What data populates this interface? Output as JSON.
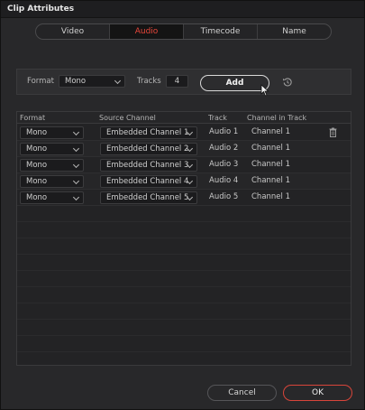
{
  "window": {
    "title": "Clip Attributes"
  },
  "tabs": [
    {
      "label": "Video",
      "active": false
    },
    {
      "label": "Audio",
      "active": true
    },
    {
      "label": "Timecode",
      "active": false
    },
    {
      "label": "Name",
      "active": false
    }
  ],
  "toolbar": {
    "format_label": "Format",
    "format_value": "Mono",
    "tracks_label": "Tracks",
    "tracks_value": "4",
    "add_label": "Add",
    "reset_icon": "reset-icon"
  },
  "table": {
    "headers": {
      "format": "Format",
      "source_channel": "Source Channel",
      "track": "Track",
      "channel_in_track": "Channel in Track"
    },
    "rows": [
      {
        "format": "Mono",
        "source_channel": "Embedded Channel 1",
        "track": "Audio 1",
        "channel_in_track": "Channel 1"
      },
      {
        "format": "Mono",
        "source_channel": "Embedded Channel 2",
        "track": "Audio 2",
        "channel_in_track": "Channel 1"
      },
      {
        "format": "Mono",
        "source_channel": "Embedded Channel 3",
        "track": "Audio 3",
        "channel_in_track": "Channel 1"
      },
      {
        "format": "Mono",
        "source_channel": "Embedded Channel 4",
        "track": "Audio 4",
        "channel_in_track": "Channel 1"
      },
      {
        "format": "Mono",
        "source_channel": "Embedded Channel 5",
        "track": "Audio 5",
        "channel_in_track": "Channel 1"
      }
    ],
    "delete_icon": "trash-icon"
  },
  "footer": {
    "cancel_label": "Cancel",
    "ok_label": "OK"
  },
  "colors": {
    "accent": "#e8463a",
    "background": "#28282a",
    "panel": "#2f2f31"
  }
}
